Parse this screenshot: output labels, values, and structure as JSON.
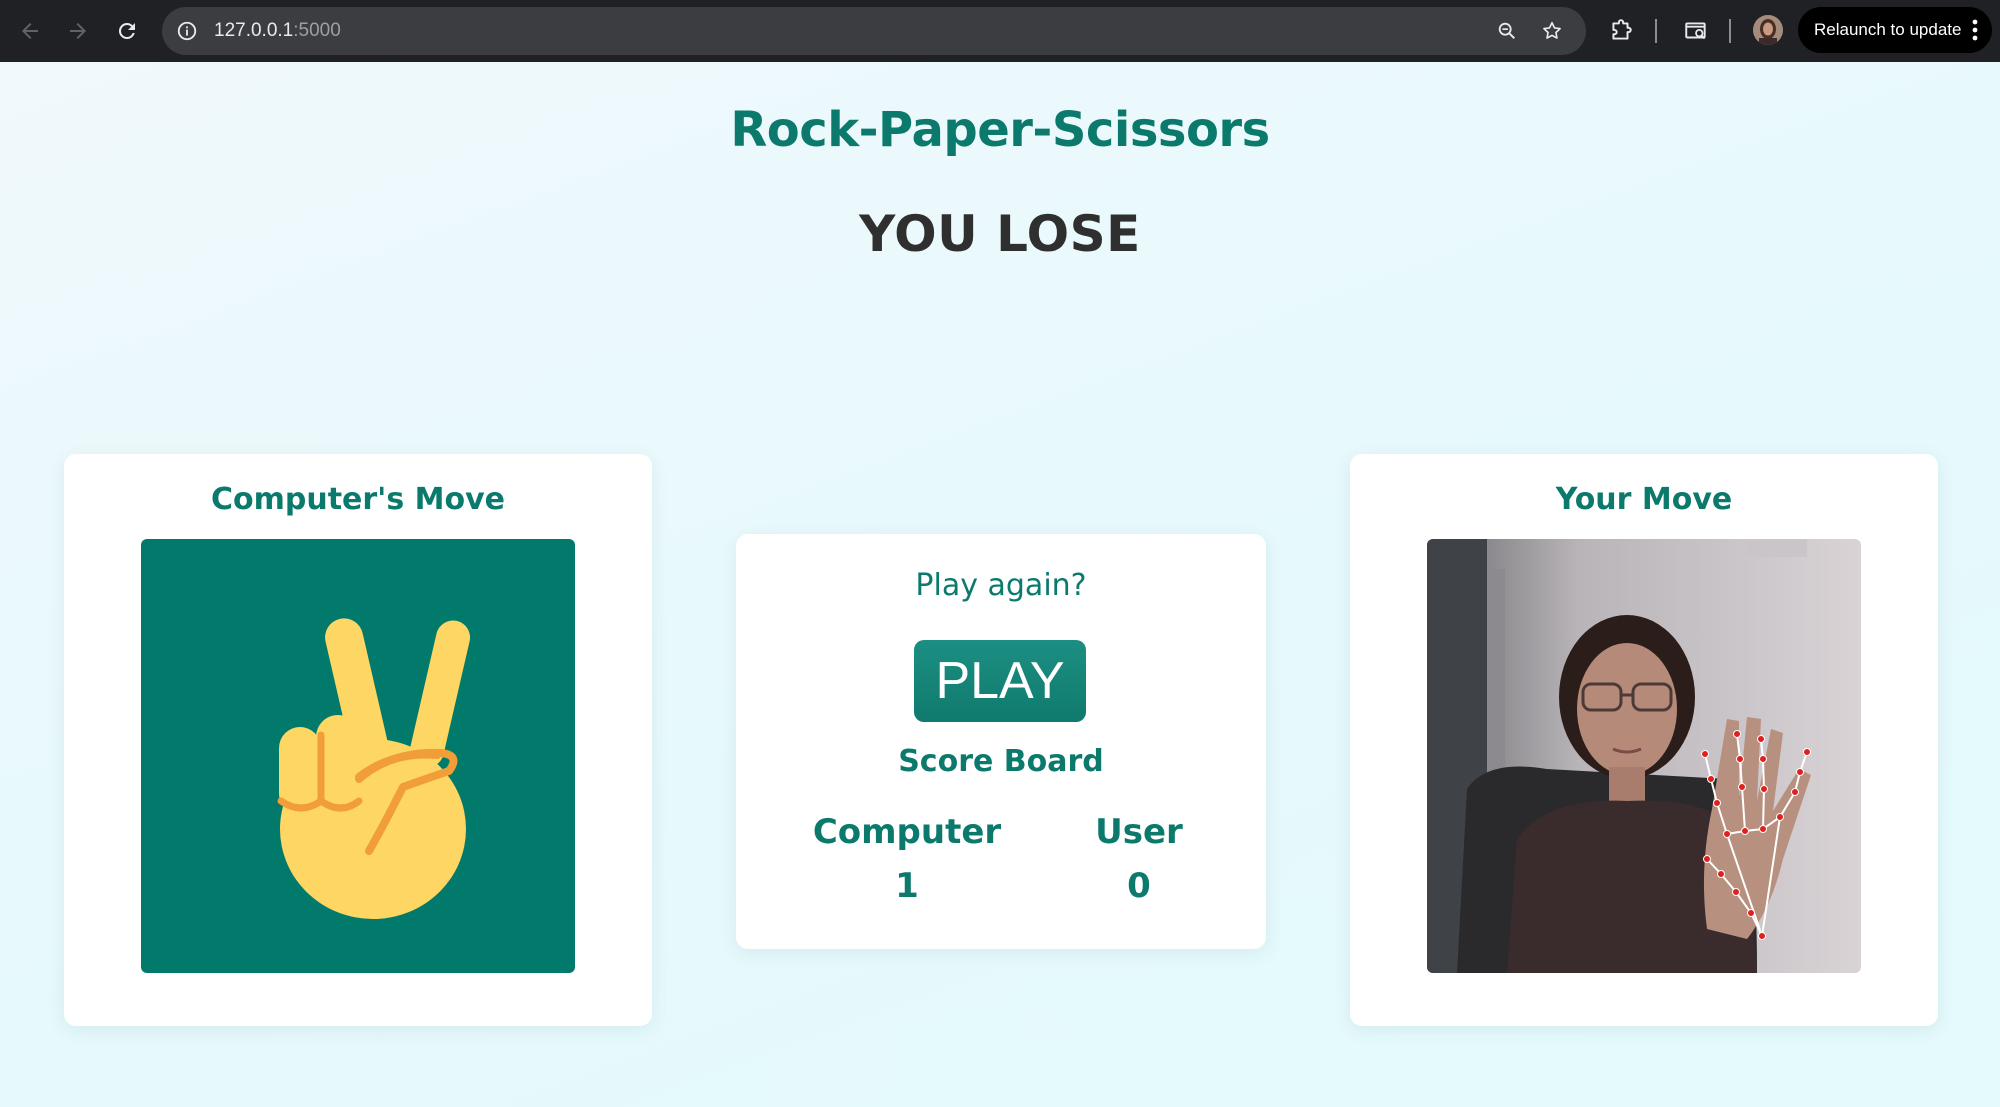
{
  "browser": {
    "url_host": "127.0.0.1",
    "url_port": ":5000",
    "relaunch_label": "Relaunch to update"
  },
  "page": {
    "title": "Rock-Paper-Scissors",
    "result": "YOU LOSE"
  },
  "computer_card": {
    "heading": "Computer's Move",
    "move_icon": "victory-hand-emoji"
  },
  "center_card": {
    "play_again": "Play again?",
    "play_button": "PLAY",
    "scoreboard_title": "Score Board",
    "computer_label": "Computer",
    "computer_score": "1",
    "user_label": "User",
    "user_score": "0"
  },
  "user_card": {
    "heading": "Your Move",
    "feed": "webcam-with-hand-landmarks"
  },
  "colors": {
    "accent": "#0b7a6c",
    "computer_bg": "#017a6c",
    "emoji_yellow": "#fdd663",
    "emoji_orange": "#f19d38",
    "landmark_red": "#e0201f"
  }
}
